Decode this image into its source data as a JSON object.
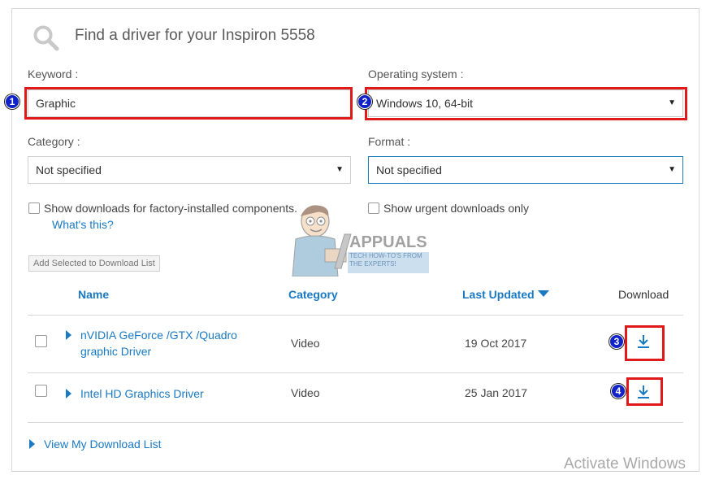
{
  "header": {
    "title": "Find a driver for your Inspiron 5558",
    "icon": "search-icon"
  },
  "keyword": {
    "label": "Keyword  :",
    "value": "Graphic",
    "marker": "1"
  },
  "os": {
    "label": "Operating system :",
    "value": "Windows 10, 64-bit",
    "marker": "2"
  },
  "category": {
    "label": "Category :",
    "value": "Not specified"
  },
  "format": {
    "label": "Format :",
    "value": "Not specified"
  },
  "options": {
    "factory_label": "Show downloads for factory-installed components.",
    "whats_this": "What's this?",
    "urgent_label": "Show urgent downloads only"
  },
  "add_selected": "Add Selected to Download List",
  "table": {
    "headers": {
      "name": "Name",
      "category": "Category",
      "last_updated": "Last Updated",
      "download": "Download"
    },
    "rows": [
      {
        "name": "nVIDIA GeForce /GTX /Quadro graphic Driver",
        "category": "Video",
        "date": "19 Oct 2017",
        "marker": "3"
      },
      {
        "name": "Intel HD Graphics Driver",
        "category": "Video",
        "date": "25 Jan 2017",
        "marker": "4"
      }
    ]
  },
  "view_list": "View My Download List",
  "watermark": {
    "brand": "APPUALS",
    "tagline": "TECH HOW-TO'S FROM THE EXPERTS!"
  },
  "system_overlay": "Activate Windows",
  "colors": {
    "link": "#1979c3",
    "highlight": "#e01a1a",
    "badge": "#1022c8"
  }
}
